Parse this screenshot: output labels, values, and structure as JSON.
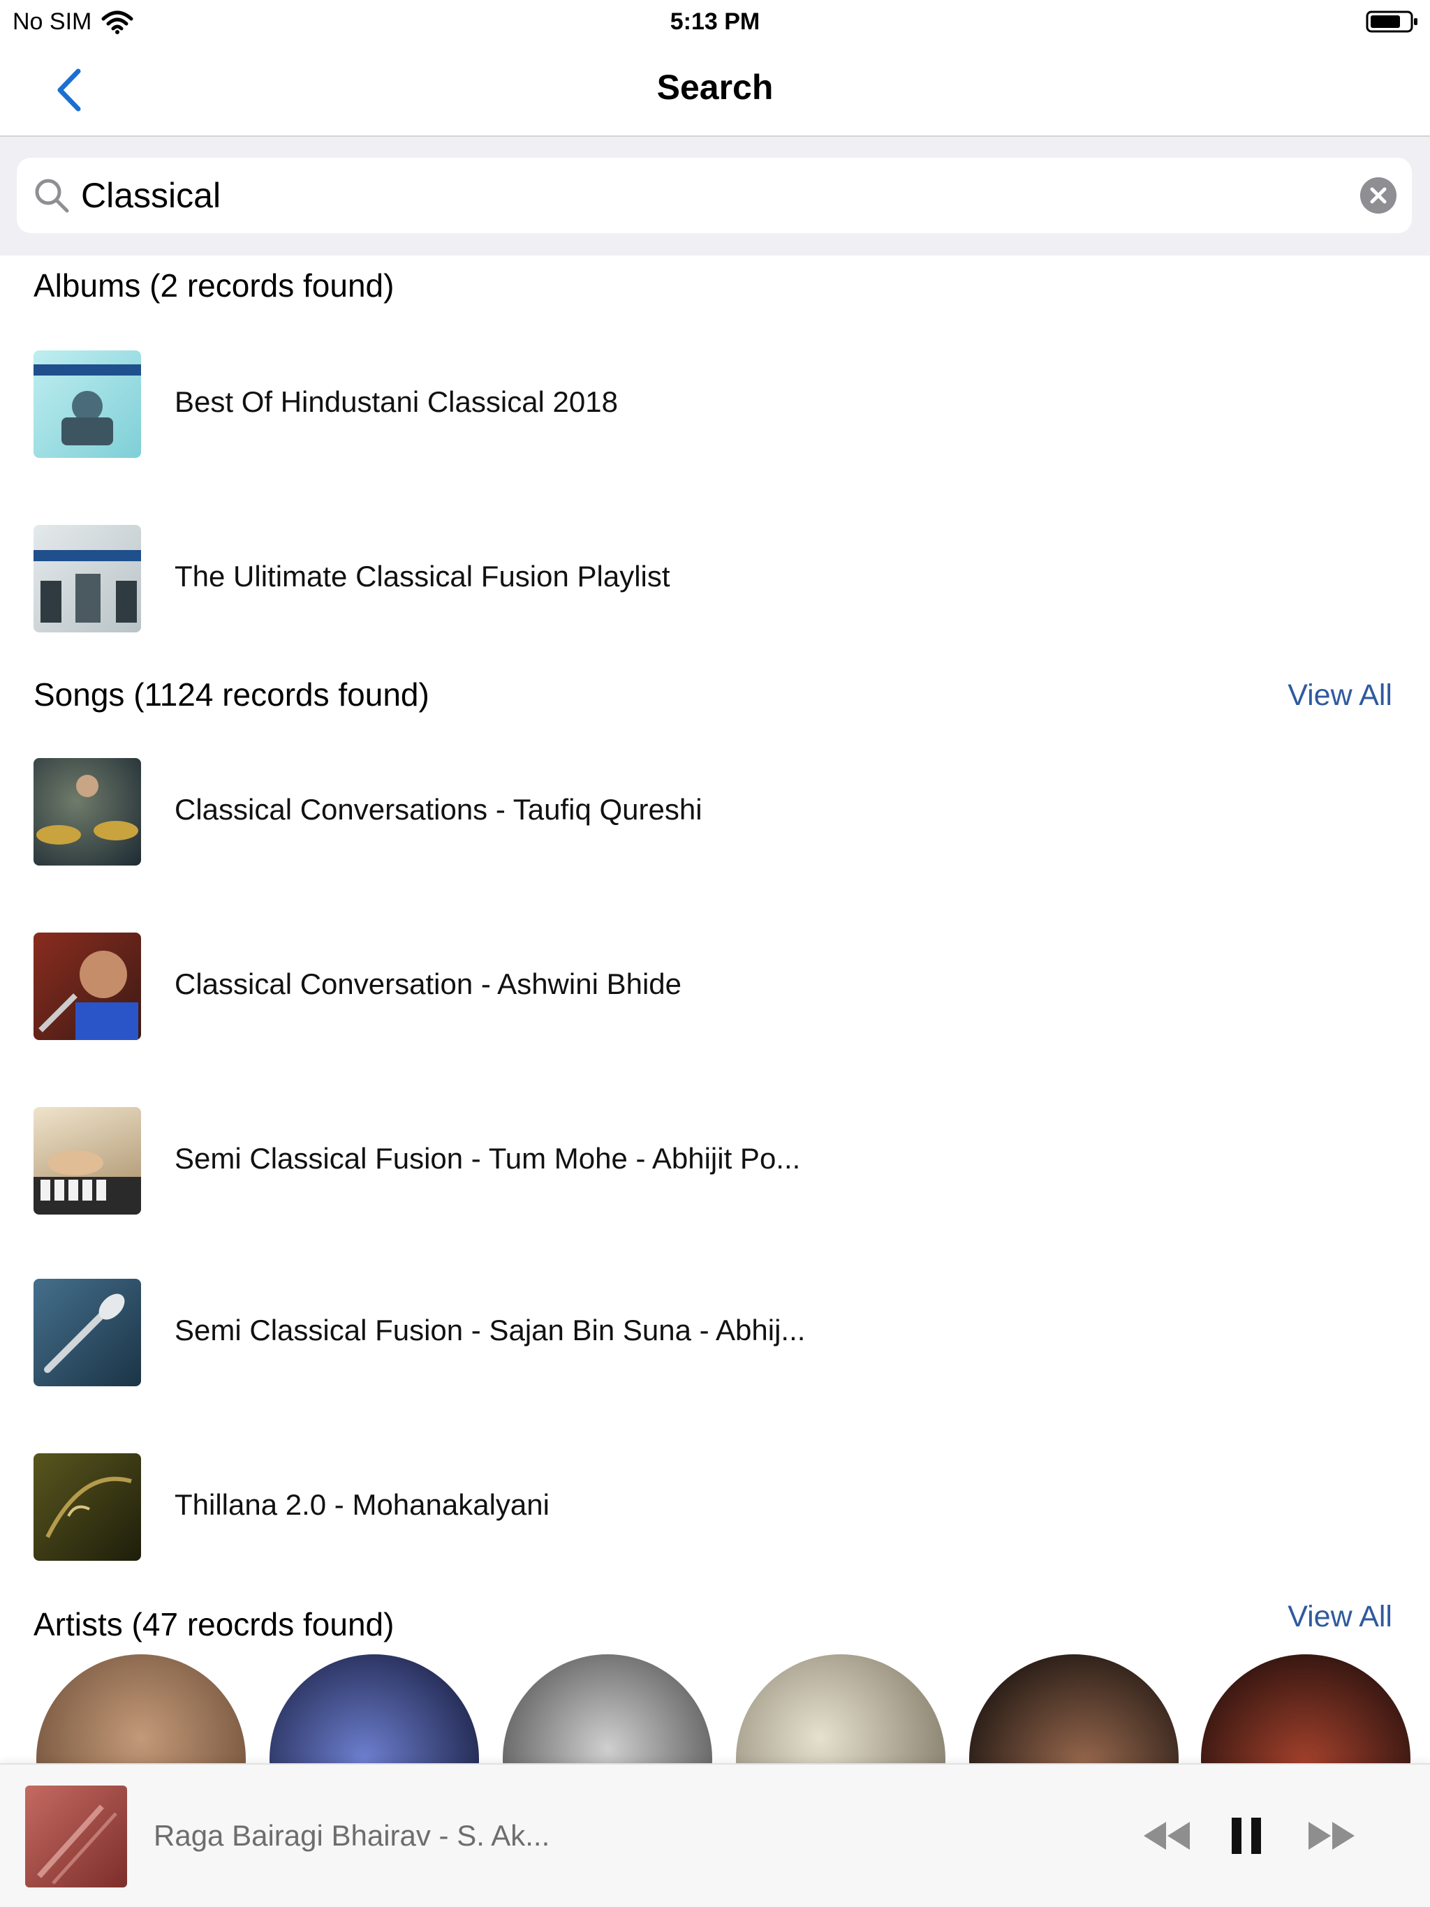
{
  "status_bar": {
    "carrier": "No SIM",
    "time": "5:13 PM"
  },
  "nav": {
    "title": "Search"
  },
  "search": {
    "value": "Classical"
  },
  "albums": {
    "header": "Albums (2 records found)",
    "items": [
      {
        "title": "Best Of Hindustani Classical 2018",
        "thumb_color": "#9fdbe0"
      },
      {
        "title": "The Ulitimate Classical Fusion Playlist",
        "thumb_color": "#cfd6d9"
      }
    ]
  },
  "songs": {
    "header": "Songs (1124 records found)",
    "view_all": "View All",
    "items": [
      {
        "title": "Classical Conversations - Taufiq Qureshi",
        "thumb_color": "#2b3b45"
      },
      {
        "title": "Classical Conversation - Ashwini Bhide",
        "thumb_color": "#7a2a22"
      },
      {
        "title": "Semi Classical Fusion - Tum Mohe - Abhijit Po...",
        "thumb_color": "#d8c7a9"
      },
      {
        "title": "Semi Classical Fusion - Sajan Bin Suna - Abhij...",
        "thumb_color": "#2f5168"
      },
      {
        "title": "Thillana 2.0 - Mohanakalyani",
        "thumb_color": "#3d3a14"
      }
    ]
  },
  "artists": {
    "header": "Artists (47 reocrds found)",
    "view_all": "View All",
    "items": [
      {
        "color": "#b08a72"
      },
      {
        "color": "#2a3360"
      },
      {
        "color": "#9c9c9c"
      },
      {
        "color": "#b7b19c"
      },
      {
        "color": "#1a1a1a"
      },
      {
        "color": "#3a1f1a"
      }
    ]
  },
  "player": {
    "title": "Raga Bairagi Bhairav - S. Ak...",
    "art_color": "#a8504a"
  },
  "colors": {
    "accent": "#2f5a9e",
    "back_arrow": "#1b6fd1",
    "separator": "#efeff4"
  }
}
